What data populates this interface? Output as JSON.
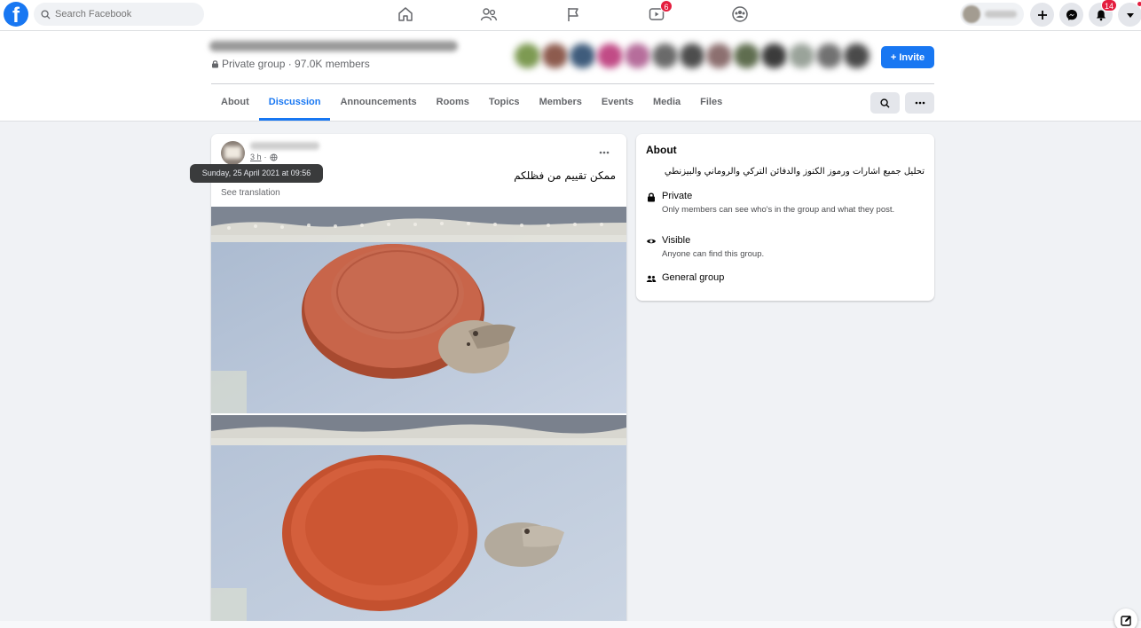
{
  "topbar": {
    "logo": "f",
    "search_placeholder": "Search Facebook",
    "watch_badge": "6",
    "notifications_badge": "14"
  },
  "group": {
    "privacy_label": "Private group · 97.0K members",
    "invite_label": "+ Invite"
  },
  "tabs": [
    {
      "label": "About"
    },
    {
      "label": "Discussion"
    },
    {
      "label": "Announcements"
    },
    {
      "label": "Rooms"
    },
    {
      "label": "Topics"
    },
    {
      "label": "Members"
    },
    {
      "label": "Events"
    },
    {
      "label": "Media"
    },
    {
      "label": "Files"
    }
  ],
  "post": {
    "time": "3 h",
    "time_sep": "·",
    "text": "ممكن تقييم من فظلكم",
    "see_translation": "See translation",
    "tooltip": "Sunday, 25 April 2021 at 09:56"
  },
  "about": {
    "title": "About",
    "description": "تحليل جميع اشارات ورموز الكنوز والدفائن التركي والروماني والبيزنطي",
    "private_title": "Private",
    "private_desc": "Only members can see who's in the group and what they post.",
    "visible_title": "Visible",
    "visible_desc": "Anyone can find this group.",
    "general_title": "General group"
  },
  "colors": {
    "accent": "#1877f2",
    "badge": "#e41e3f",
    "bowl": "#c65a3c"
  }
}
